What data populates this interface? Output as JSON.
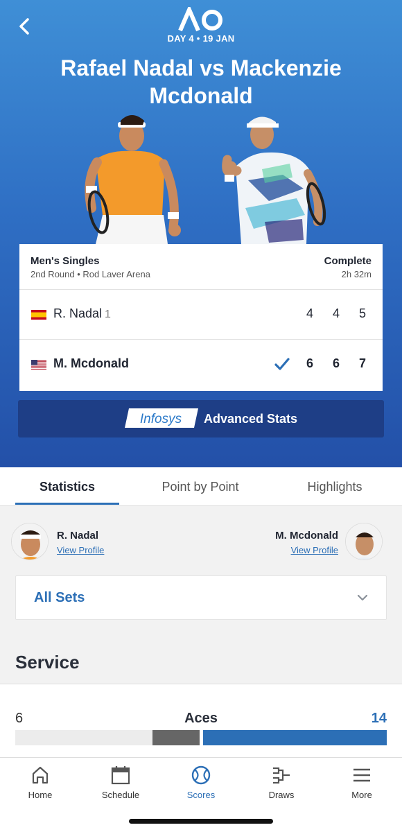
{
  "header": {
    "logo_text": "AO",
    "day_line": "DAY 4 • 19 JAN",
    "title": "Rafael Nadal vs Mackenzie Mcdonald"
  },
  "match": {
    "event": "Men's Singles",
    "round_venue": "2nd Round • Rod Laver Arena",
    "status": "Complete",
    "duration": "2h 32m",
    "players": [
      {
        "name": "R. Nadal",
        "seed": "1",
        "country": "ESP",
        "sets": [
          "4",
          "4",
          "5"
        ],
        "winner": false
      },
      {
        "name": "M. Mcdonald",
        "seed": "",
        "country": "USA",
        "sets": [
          "6",
          "6",
          "7"
        ],
        "winner": true
      }
    ]
  },
  "advanced_stats": {
    "brand": "Infosys",
    "label": "Advanced Stats"
  },
  "tabs": [
    {
      "label": "Statistics",
      "active": true
    },
    {
      "label": "Point by Point",
      "active": false
    },
    {
      "label": "Highlights",
      "active": false
    }
  ],
  "profiles": {
    "left": {
      "name": "R. Nadal",
      "link": "View Profile"
    },
    "right": {
      "name": "M. Mcdonald",
      "link": "View Profile"
    }
  },
  "set_filter": {
    "selected": "All Sets"
  },
  "section": {
    "title": "Service"
  },
  "stat": {
    "name": "Aces",
    "left_value": 6,
    "right_value": 14
  },
  "nav": [
    {
      "label": "Home",
      "icon": "home-icon",
      "active": false
    },
    {
      "label": "Schedule",
      "icon": "calendar-icon",
      "active": false
    },
    {
      "label": "Scores",
      "icon": "tennis-ball-icon",
      "active": true
    },
    {
      "label": "Draws",
      "icon": "bracket-icon",
      "active": false
    },
    {
      "label": "More",
      "icon": "menu-icon",
      "active": false
    }
  ],
  "colors": {
    "accent": "#2c6fb6",
    "hero_top": "#3f8fd6",
    "hero_bottom": "#2350a8",
    "adv_bar": "#1e3e86"
  }
}
